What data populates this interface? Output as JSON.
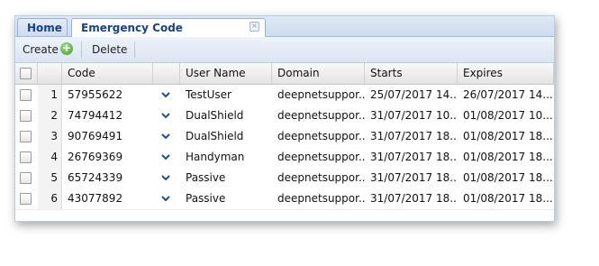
{
  "tabs": [
    {
      "label": "Home"
    },
    {
      "label": "Emergency Code Management"
    }
  ],
  "toolbar": {
    "create_label": "Create",
    "delete_label": "Delete"
  },
  "grid": {
    "columns": [
      "Code",
      "User Name",
      "Domain",
      "Starts",
      "Expires"
    ],
    "rows": [
      {
        "num": "1",
        "code": "57955622",
        "user": "TestUser",
        "domain": "deepnetsuppor...",
        "starts": "25/07/2017 14...",
        "expires": "26/07/2017 14..."
      },
      {
        "num": "2",
        "code": "74794412",
        "user": "DualShield",
        "domain": "deepnetsuppor...",
        "starts": "31/07/2017 10...",
        "expires": "01/08/2017 10..."
      },
      {
        "num": "3",
        "code": "90769491",
        "user": "DualShield",
        "domain": "deepnetsuppor...",
        "starts": "31/07/2017 18...",
        "expires": "01/08/2017 18..."
      },
      {
        "num": "4",
        "code": "26769369",
        "user": "Handyman",
        "domain": "deepnetsuppor...",
        "starts": "31/07/2017 18...",
        "expires": "01/08/2017 18..."
      },
      {
        "num": "5",
        "code": "65724339",
        "user": "Passive",
        "domain": "deepnetsuppor...",
        "starts": "31/07/2017 18...",
        "expires": "01/08/2017 18..."
      },
      {
        "num": "6",
        "code": "43077892",
        "user": "Passive",
        "domain": "deepnetsuppor...",
        "starts": "31/07/2017 18...",
        "expires": "01/08/2017 18..."
      }
    ]
  },
  "icons": {
    "add": "add-circle-icon",
    "close": "close-icon",
    "expand": "chevron-down-icon"
  },
  "colors": {
    "tab_text": "#15428b",
    "accent_border": "#99bbe8",
    "chevron": "#1f4e8c"
  }
}
